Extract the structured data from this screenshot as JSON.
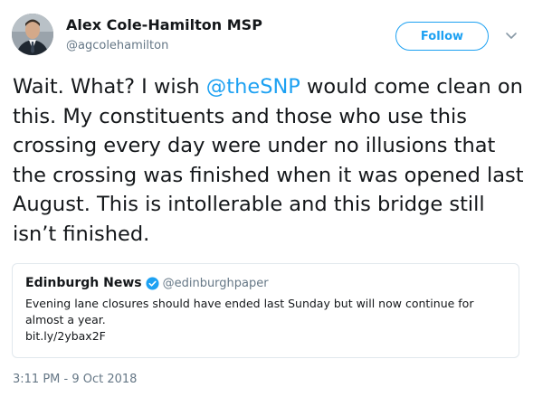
{
  "author": {
    "name": "Alex Cole-Hamilton MSP",
    "handle": "@agcolehamilton",
    "avatar_icon": "person-avatar"
  },
  "actions": {
    "follow_label": "Follow",
    "menu_icon": "chevron-down-icon"
  },
  "tweet": {
    "text_before_mention": "Wait. What? I wish ",
    "mention": "@theSNP",
    "text_after_mention": " would come clean on this. My constituents and those who use this crossing every day were under no illusions that the crossing was finished when it was opened last August. This is intollerable and this bridge still isn’t finished.",
    "timestamp": "3:11 PM - 9 Oct 2018"
  },
  "quoted_tweet": {
    "name": "Edinburgh News",
    "verified_icon": "verified-badge-icon",
    "handle": "@edinburghpaper",
    "text": "Evening lane closures should have ended last Sunday but will now continue for almost a year.",
    "link": "bit.ly/2ybax2F"
  },
  "colors": {
    "accent": "#1da1f2",
    "secondary_text": "#657786",
    "border": "#e1e8ed"
  }
}
